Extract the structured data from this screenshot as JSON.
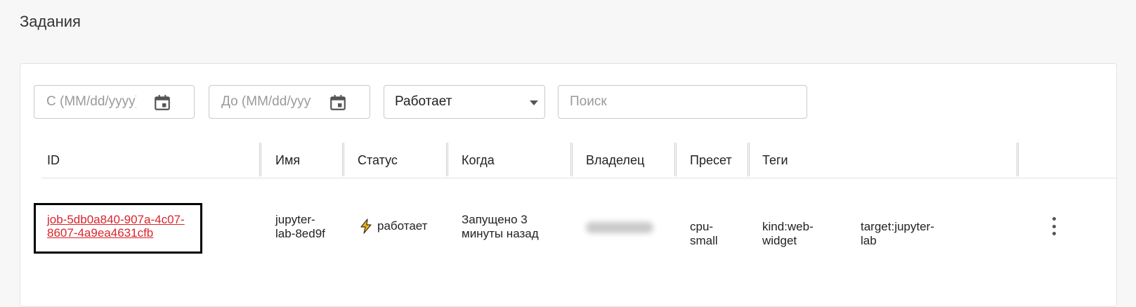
{
  "page": {
    "title": "Задания"
  },
  "filters": {
    "from_placeholder": "С (MM/dd/yyyy)",
    "to_placeholder": "До (MM/dd/yyyy)",
    "status_value": "Работает",
    "search_placeholder": "Поиск"
  },
  "table": {
    "columns": [
      "ID",
      "Имя",
      "Статус",
      "Когда",
      "Владелец",
      "Пресет",
      "Теги"
    ],
    "rows": [
      {
        "id": "job-5db0a840-907a-4c07-8607-4a9ea4631cfb",
        "name": "jupyter-lab-8ed9f",
        "status": "работает",
        "status_icon": "bolt-icon",
        "when": "Запущено 3 минуты назад",
        "owner": "",
        "preset": "cpu-small",
        "tags": [
          "kind:web-widget",
          "target:jupyter-lab"
        ]
      }
    ]
  },
  "colors": {
    "link": "#d9252b",
    "status_icon": "#f2b400"
  }
}
